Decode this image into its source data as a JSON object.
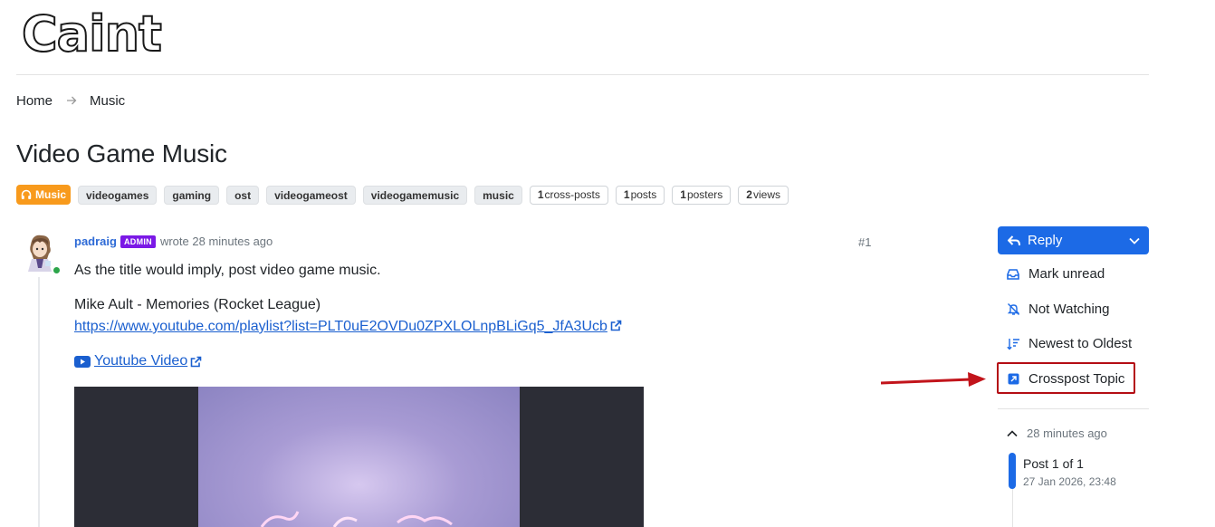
{
  "site": {
    "logo_text": "Caint"
  },
  "breadcrumb": {
    "home": "Home",
    "current": "Music"
  },
  "topic": {
    "title": "Video Game Music",
    "category": "Music",
    "tags": [
      "videogames",
      "gaming",
      "ost",
      "videogameost",
      "videogamemusic",
      "music"
    ],
    "stats": [
      {
        "value": "1",
        "label": "cross-posts"
      },
      {
        "value": "1",
        "label": "posts"
      },
      {
        "value": "1",
        "label": "posters"
      },
      {
        "value": "2",
        "label": "views"
      }
    ]
  },
  "post": {
    "author": "padraig",
    "badge": "ADMIN",
    "time": "wrote 28 minutes ago",
    "index": "#1",
    "line1": "As the title would imply, post video game music.",
    "line2": "Mike Ault - Memories (Rocket League)",
    "link_url": "https://www.youtube.com/playlist?list=PLT0uE2OVDu0ZPXLOLnpBLiGq5_JfA3Ucb",
    "video_link": "Youtube Video"
  },
  "sidebar": {
    "reply": "Reply",
    "mark_unread": "Mark unread",
    "watching": "Not Watching",
    "sort": "Newest to Oldest",
    "crosspost": "Crosspost Topic",
    "ago": "28 minutes ago",
    "post_of": "Post 1 of 1",
    "post_date": "27 Jan 2026, 23:48"
  },
  "colors": {
    "accent": "#1c6ae6",
    "category": "#f89a1c",
    "admin_badge": "#7b19e6",
    "highlight": "#b40d14"
  }
}
